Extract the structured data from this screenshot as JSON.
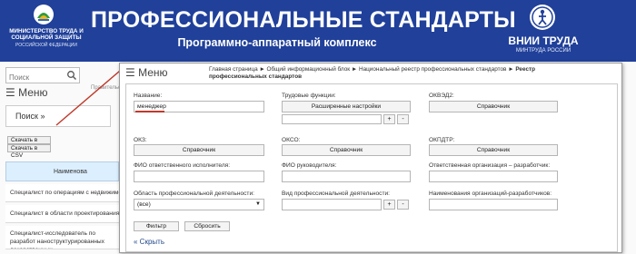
{
  "header": {
    "ministry_line1": "МИНИСТЕРСТВО ТРУДА И СОЦИАЛЬНОЙ ЗАЩИТЫ",
    "ministry_line2": "РОССИЙСКОЙ ФЕДЕРАЦИИ",
    "title": "ПРОФЕССИОНАЛЬНЫЕ СТАНДАРТЫ",
    "subtitle": "Программно-аппаратный комплекс",
    "vnii_line1": "ВНИИ ТРУДА",
    "vnii_line2": "МИНТРУДА РОССИИ",
    "bg_color": "#20409a"
  },
  "background_page": {
    "search_placeholder": "Поиск",
    "menu_label": "Меню",
    "search_button": "Поиск »",
    "download_xml": "Скачать в XML",
    "download_csv": "Скачать в CSV",
    "government_label": "Правительство",
    "table_header": "Наименова",
    "rows": [
      "Специалист по операциям с недвижимо",
      "Специалист в области проектирования т",
      "Специалист-исследователь по разработ наноструктурированных лекарственных"
    ]
  },
  "panel": {
    "menu_label": "Меню",
    "breadcrumb": {
      "items": [
        "Главная страница",
        "Общий информационный блок",
        "Национальный реестр профессиональных стандартов"
      ],
      "current": "Реестр профессиональных стандартов",
      "separator": "►"
    },
    "fields": {
      "name_label": "Название:",
      "name_value": "менеджер",
      "labor_functions_label": "Трудовые функции:",
      "advanced_settings_button": "Расширенные настройки",
      "plus": "+",
      "minus": "-",
      "okvzd_label": "ОКВЭД2:",
      "okz_label": "ОКЗ:",
      "okso_label": "ОКСО:",
      "okpdtr_label": "ОКПДТР:",
      "reference_button": "Справочник",
      "responsible_executor_label": "ФИО ответственного исполнителя:",
      "head_label": "ФИО руководителя:",
      "responsible_org_label": "Ответственная организация – разработчик:",
      "activity_area_label": "Область профессиональной деятельности:",
      "activity_area_value": "(все)",
      "activity_type_label": "Вид профессиональной деятельности:",
      "dev_orgs_label": "Наименования организаций-разработчиков:"
    },
    "filter_button": "Фильтр",
    "reset_button": "Сбросить",
    "hide_link": "« Скрыть"
  },
  "colors": {
    "accent_red": "#c0392b",
    "link_blue": "#234a8a"
  }
}
